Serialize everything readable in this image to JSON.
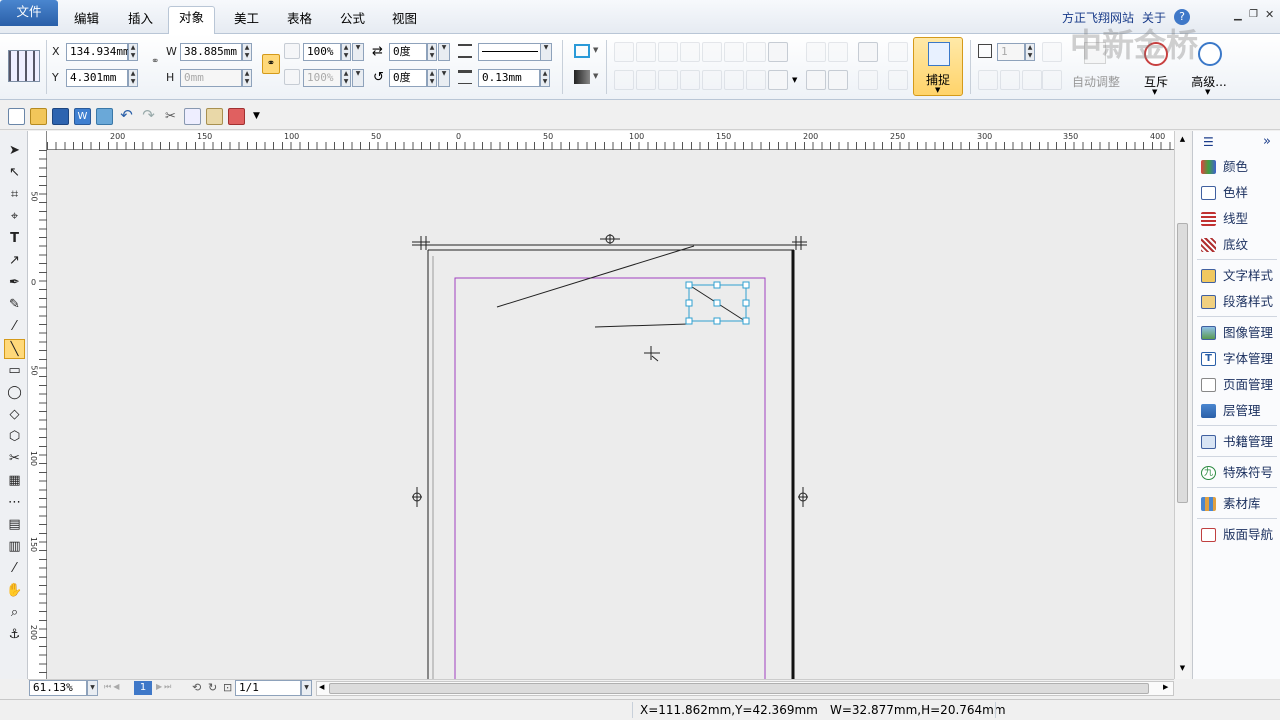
{
  "menubar": {
    "file": "文件",
    "tabs": [
      "编辑",
      "插入",
      "对象",
      "美工",
      "表格",
      "公式",
      "视图"
    ],
    "active_tab": "对象",
    "website": "方正飞翔网站",
    "about": "关于",
    "watermark": "中新金桥"
  },
  "ribbon": {
    "x_label": "X",
    "x_value": "134.934mm",
    "y_label": "Y",
    "y_value": "4.301mm",
    "w_label": "W",
    "w_value": "38.885mm",
    "h_label": "H",
    "h_value": "0mm",
    "scale_x": "100%",
    "scale_y": "100%",
    "rotate_value": "0度",
    "skew_value": "0度",
    "stroke_width": "0.13mm",
    "column_count": "1",
    "snap_label": "捕捉",
    "auto_adjust_label": "自动调整",
    "exclusive_label": "互斥",
    "advanced_label": "高级..."
  },
  "ruler": {
    "h_ticks": [
      "200",
      "150",
      "100",
      "50",
      "0",
      "50",
      "100",
      "150",
      "200",
      "250",
      "300",
      "350",
      "400"
    ],
    "v_ticks": [
      "50",
      "0",
      "50",
      "100",
      "150",
      "200"
    ]
  },
  "panel": {
    "items": [
      "颜色",
      "色样",
      "线型",
      "底纹",
      "文字样式",
      "段落样式",
      "图像管理",
      "字体管理",
      "页面管理",
      "层管理",
      "书籍管理",
      "特殊符号",
      "素材库",
      "版面导航"
    ]
  },
  "bottom": {
    "zoom": "61.13%",
    "page_current": "1",
    "page_count": "1/1"
  },
  "status": {
    "position": "X=111.862mm,Y=42.369mm",
    "size": "W=32.877mm,H=20.764mm"
  },
  "colors": {
    "accent": "#2a5fa8",
    "snap_active": "#ffd97a",
    "margin_guide": "#a040c0",
    "selection": "#30a0d0"
  }
}
